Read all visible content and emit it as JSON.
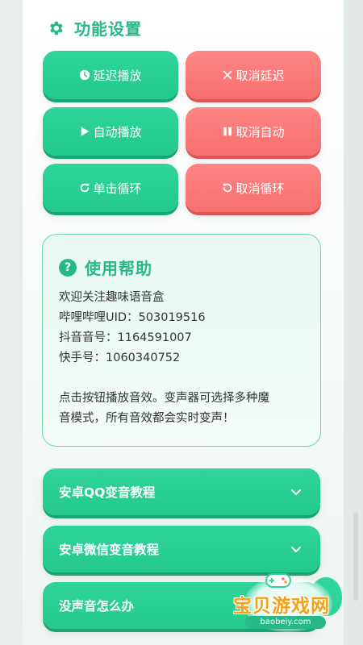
{
  "section": {
    "title": "功能设置",
    "icon": "gear-icon"
  },
  "buttons": {
    "delay_play": {
      "label": "延迟播放",
      "icon": "clock-icon"
    },
    "cancel_delay": {
      "label": "取消延迟",
      "icon": "close-icon"
    },
    "auto_play": {
      "label": "自动播放",
      "icon": "play-icon"
    },
    "cancel_auto": {
      "label": "取消自动",
      "icon": "pause-icon"
    },
    "single_loop": {
      "label": "单击循环",
      "icon": "redo-icon"
    },
    "cancel_loop": {
      "label": "取消循环",
      "icon": "undo-icon"
    }
  },
  "help": {
    "title": "使用帮助",
    "icon_glyph": "?",
    "lines": [
      "欢迎关注趣味语音盒",
      "哔哩哔哩UID：503019516",
      "抖音音号：1164591007",
      "快手号：1060340752"
    ],
    "note_lines": [
      "点击按钮播放音效。变声器可选择多种魔",
      "音模式，所有音效都会实时变声！"
    ]
  },
  "accordion": [
    {
      "label": "安卓QQ变音教程"
    },
    {
      "label": "安卓微信变音教程"
    },
    {
      "label": "没声音怎么办"
    }
  ],
  "watermark": {
    "text": "宝贝游戏网",
    "url": "baobeiy.com"
  },
  "colors": {
    "green": "#27b889",
    "button_green": "#2fd49a",
    "button_red": "#f76f6f",
    "card_border": "#6fd8b0",
    "watermark_orange": "#f0a21a"
  }
}
